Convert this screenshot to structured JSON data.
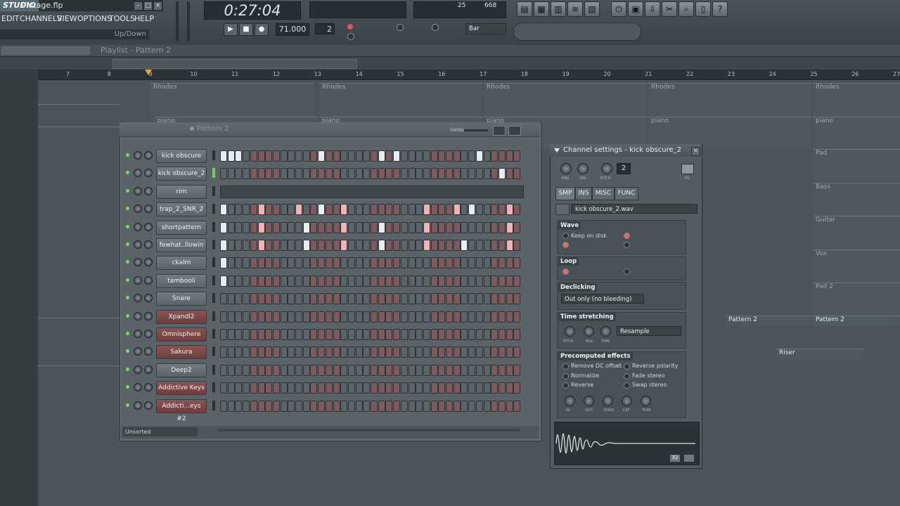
{
  "app": {
    "brand": "STUDIO",
    "file_name": "Vintage.flp"
  },
  "menu": [
    "EDIT",
    "CHANNELS",
    "VIEW",
    "OPTIONS",
    "TOOLS",
    "HELP"
  ],
  "hint": "Up/Down",
  "transport": {
    "time": "0:27:04",
    "tempo": "71.000",
    "pattern": "2",
    "snap": "Bar",
    "cpu": "25",
    "mem": "668"
  },
  "playlist": {
    "title": "Playlist - Pattern 2",
    "ruler": [
      "7",
      "8",
      "9",
      "10",
      "11",
      "12",
      "13",
      "14",
      "15",
      "16",
      "17",
      "18",
      "19",
      "20",
      "21",
      "22",
      "23",
      "24",
      "25",
      "26",
      "27"
    ],
    "tracks": [
      "Rhodes",
      "Rhodes",
      "Rhodes",
      "Rhodes",
      "Rhodes",
      "piano",
      "piano",
      "piano",
      "piano",
      "piano",
      "Pad",
      "Bass",
      "Guitar",
      "Vox",
      "Pad 2",
      "Pattern 2",
      "Pattern 2",
      "Riser"
    ]
  },
  "channel_rack": {
    "title": "Pattern 2",
    "swing_label": "SWING",
    "filter": "Unsorted",
    "channels": [
      {
        "name": "kick obscure",
        "color": "grey",
        "steps": [
          1,
          1,
          1,
          0,
          0,
          0,
          0,
          0,
          0,
          0,
          0,
          0,
          0,
          1,
          0,
          0,
          0,
          0,
          0,
          0,
          0,
          1,
          0,
          1,
          0,
          0,
          0,
          0,
          0,
          0,
          0,
          0,
          0,
          0,
          1,
          0,
          0,
          0,
          0,
          0,
          0,
          0
        ]
      },
      {
        "name": "kick obscure_2",
        "color": "grey",
        "steps": [
          0,
          0,
          0,
          0,
          0,
          0,
          0,
          0,
          0,
          0,
          0,
          0,
          0,
          0,
          0,
          0,
          0,
          0,
          0,
          0,
          0,
          0,
          0,
          0,
          0,
          0,
          0,
          0,
          0,
          0,
          0,
          0,
          0,
          0,
          0,
          0,
          0,
          1,
          0,
          0,
          0,
          2
        ]
      },
      {
        "name": "rim",
        "color": "grey",
        "steps": []
      },
      {
        "name": "trap_2_SNR_2",
        "color": "grey",
        "steps": [
          1,
          0,
          0,
          0,
          0,
          2,
          0,
          0,
          0,
          0,
          2,
          0,
          0,
          1,
          0,
          0,
          2,
          0,
          0,
          0,
          0,
          0,
          0,
          0,
          0,
          0,
          0,
          2,
          0,
          0,
          0,
          2,
          0,
          1,
          0,
          0,
          0,
          0,
          2,
          0,
          0,
          0
        ]
      },
      {
        "name": "shortpattern",
        "color": "grey",
        "steps": [
          1,
          0,
          0,
          0,
          0,
          2,
          0,
          0,
          0,
          0,
          0,
          1,
          0,
          0,
          0,
          0,
          2,
          0,
          0,
          0,
          0,
          1,
          0,
          0,
          0,
          0,
          0,
          2,
          0,
          0,
          0,
          0,
          0,
          0,
          0,
          0,
          0,
          0,
          2,
          0,
          0,
          0
        ]
      },
      {
        "name": "fewhat..llowin",
        "color": "grey",
        "steps": [
          1,
          0,
          0,
          0,
          0,
          2,
          0,
          0,
          0,
          0,
          0,
          1,
          0,
          0,
          0,
          0,
          2,
          0,
          0,
          0,
          0,
          1,
          0,
          0,
          0,
          0,
          0,
          2,
          0,
          0,
          0,
          0,
          1,
          0,
          0,
          0,
          0,
          0,
          2,
          0,
          0,
          0
        ]
      },
      {
        "name": "ckalm",
        "color": "grey",
        "steps": [
          1,
          0,
          0,
          0,
          0,
          0,
          0,
          0,
          0,
          0,
          0,
          0,
          0,
          0,
          0,
          0,
          0,
          0,
          0,
          0,
          0,
          0,
          0,
          0,
          0,
          0,
          0,
          0,
          0,
          0,
          0,
          0,
          0,
          0,
          0,
          0,
          0,
          0,
          0,
          0,
          0,
          0
        ]
      },
      {
        "name": "tambooli",
        "color": "grey",
        "steps": [
          1,
          0,
          0,
          0,
          0,
          0,
          0,
          0,
          0,
          0,
          0,
          0,
          0,
          0,
          0,
          0,
          0,
          0,
          0,
          0,
          0,
          0,
          0,
          0,
          0,
          0,
          0,
          0,
          0,
          0,
          0,
          0,
          0,
          0,
          0,
          0,
          0,
          0,
          0,
          0,
          0,
          0
        ]
      },
      {
        "name": "Snare",
        "color": "grey",
        "steps": [
          0,
          0,
          0,
          0,
          0,
          0,
          0,
          0,
          0,
          0,
          0,
          0,
          0,
          0,
          0,
          0,
          0,
          0,
          0,
          0,
          0,
          0,
          0,
          0,
          0,
          0,
          0,
          0,
          0,
          0,
          0,
          0,
          0,
          0,
          0,
          0,
          0,
          0,
          0,
          0,
          0,
          0
        ]
      },
      {
        "name": "Xpandl2",
        "color": "red",
        "steps": [
          0,
          0,
          0,
          0,
          0,
          0,
          0,
          0,
          0,
          0,
          0,
          0,
          0,
          0,
          0,
          0,
          0,
          0,
          0,
          0,
          0,
          0,
          0,
          0,
          0,
          0,
          0,
          0,
          0,
          0,
          0,
          0,
          0,
          0,
          0,
          0,
          0,
          0,
          0,
          0,
          0,
          0
        ]
      },
      {
        "name": "Omnisphere",
        "color": "red",
        "steps": [
          0,
          0,
          0,
          0,
          0,
          0,
          0,
          0,
          0,
          0,
          0,
          0,
          0,
          0,
          0,
          0,
          0,
          0,
          0,
          0,
          0,
          0,
          0,
          0,
          0,
          0,
          0,
          0,
          0,
          0,
          0,
          0,
          0,
          0,
          0,
          0,
          0,
          0,
          0,
          0,
          0,
          0
        ]
      },
      {
        "name": "Sakura",
        "color": "red",
        "steps": [
          0,
          0,
          0,
          0,
          0,
          0,
          0,
          0,
          0,
          0,
          0,
          0,
          0,
          0,
          0,
          0,
          0,
          0,
          0,
          0,
          0,
          0,
          0,
          0,
          0,
          0,
          0,
          0,
          0,
          0,
          0,
          0,
          0,
          0,
          0,
          0,
          0,
          0,
          0,
          0,
          0,
          0
        ]
      },
      {
        "name": "Deep2",
        "color": "grey",
        "steps": [
          0,
          0,
          0,
          0,
          0,
          0,
          0,
          0,
          0,
          0,
          0,
          0,
          0,
          0,
          0,
          0,
          0,
          0,
          0,
          0,
          0,
          0,
          0,
          0,
          0,
          0,
          0,
          0,
          0,
          0,
          0,
          0,
          0,
          0,
          0,
          0,
          0,
          0,
          0,
          0,
          0,
          0
        ]
      },
      {
        "name": "Addictive Keys",
        "color": "red",
        "steps": [
          0,
          0,
          0,
          0,
          0,
          0,
          0,
          0,
          0,
          0,
          0,
          0,
          0,
          0,
          0,
          0,
          0,
          0,
          0,
          0,
          0,
          0,
          0,
          0,
          0,
          0,
          0,
          0,
          0,
          0,
          0,
          0,
          0,
          0,
          0,
          0,
          0,
          0,
          0,
          0,
          0,
          0
        ]
      },
      {
        "name": "Addicti...eys #2",
        "color": "red",
        "steps": [
          0,
          0,
          0,
          0,
          0,
          0,
          0,
          0,
          0,
          0,
          0,
          0,
          0,
          0,
          0,
          0,
          0,
          0,
          0,
          0,
          0,
          0,
          0,
          0,
          0,
          0,
          0,
          0,
          0,
          0,
          0,
          0,
          0,
          0,
          0,
          0,
          0,
          0,
          0,
          0,
          0,
          0
        ]
      }
    ]
  },
  "channel_settings": {
    "title": "Channel settings - kick obscure_2",
    "knob_labels": [
      "PAN",
      "VOL",
      "PITCH"
    ],
    "tracker": "2",
    "fx_label": "FX",
    "tabs": [
      "SMP",
      "INS",
      "MISC",
      "FUNC"
    ],
    "sample": "kick obscure_2.wav",
    "wave_title": "Wave",
    "wave_opts": [
      "Keep on disk"
    ],
    "loop_title": "Loop",
    "declick_title": "Declicking",
    "declick_value": "Out only (no bleeding)",
    "stretch_title": "Time stretching",
    "stretch_knobs": [
      "PITCH",
      "MUL",
      "TIME"
    ],
    "stretch_mode": "Resample",
    "precomp_title": "Precomputed effects",
    "precomp_left": [
      "Remove DC offset",
      "Normalize",
      "Reverse"
    ],
    "precomp_right": [
      "Reverse polarity",
      "Fade stereo",
      "Swap stereo"
    ],
    "precomp_knobs": [
      "IN",
      "OUT",
      "PONG",
      "CRF",
      "TRIM"
    ],
    "wave_badge": "32"
  }
}
